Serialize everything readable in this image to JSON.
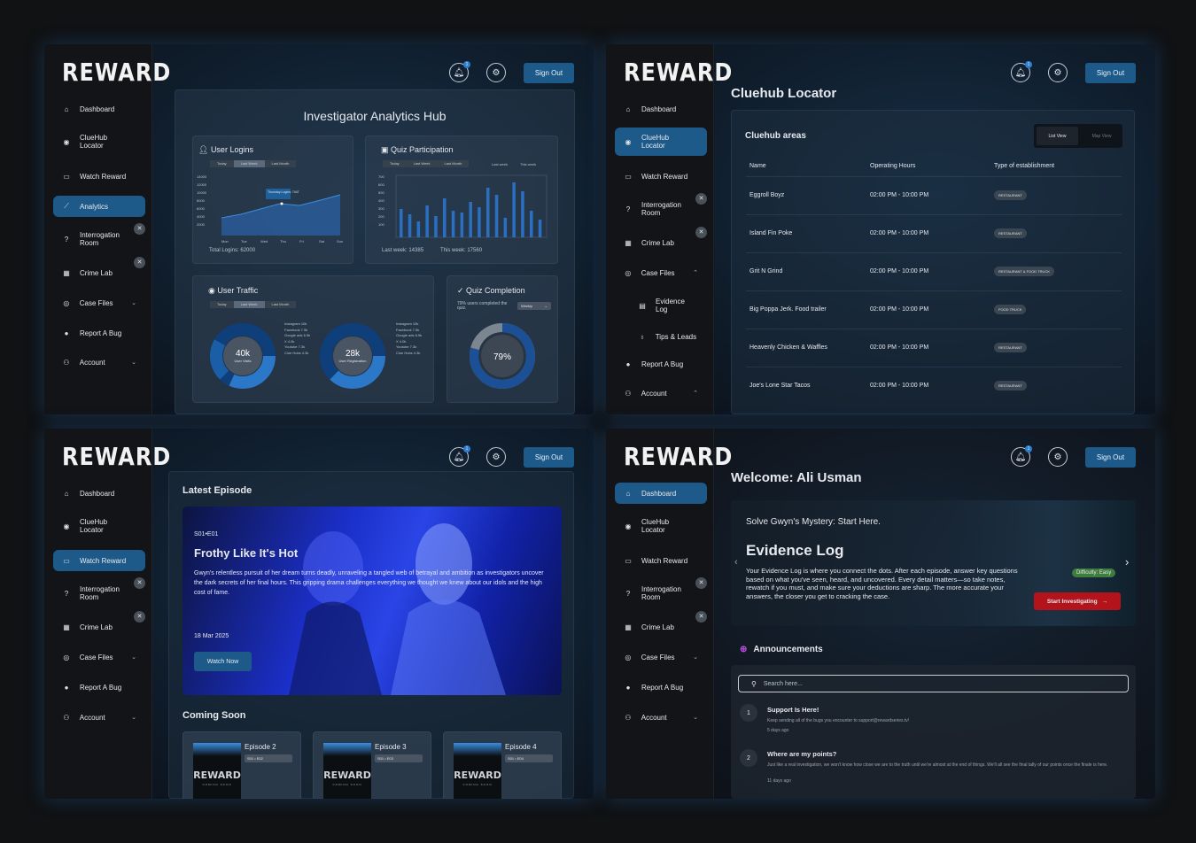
{
  "brand": "REWARD",
  "top": {
    "sign_out": "Sign Out",
    "notif_count": "1",
    "bell_icon": "bell-icon",
    "gear_icon": "gear-icon"
  },
  "nav1": [
    "Dashboard",
    "ClueHub Locator",
    "Watch Reward",
    "Analytics",
    "Interrogation Room",
    "Crime Lab",
    "Case Files",
    "Report A Bug",
    "Account"
  ],
  "nav2": [
    "Dashboard",
    "ClueHub Locator",
    "Watch Reward",
    "Interrogation Room",
    "Crime Lab",
    "Case Files",
    "Evidence Log",
    "Tips & Leads",
    "Report A Bug",
    "Account"
  ],
  "analytics": {
    "title": "Investigator Analytics Hub",
    "logins": {
      "title": "User Logins",
      "tabs": [
        "Today",
        "Last Week",
        "Last Month"
      ],
      "total": "Total Logins: 62000",
      "tooltip": "Thursday Logins: 7447",
      "ylabels": [
        "14000",
        "12000",
        "10000",
        "8000",
        "6000",
        "4000",
        "2000"
      ],
      "days": [
        "Mon",
        "Tue",
        "Wed",
        "Thu",
        "Fri",
        "Sat",
        "Sun"
      ]
    },
    "quiz": {
      "title": "Quiz Participation",
      "tabs": [
        "Today",
        "Last Week",
        "Last Month"
      ],
      "tabs2": [
        "Last week",
        "This week"
      ],
      "ylabels": [
        "700",
        "600",
        "500",
        "400",
        "300",
        "200",
        "100"
      ],
      "last_week": "Last week: 14385",
      "this_week": "This week: 17560"
    },
    "traffic": {
      "title": "User Traffic",
      "tabs": [
        "Today",
        "Last Week",
        "Last Month"
      ],
      "donut1_value": "40k",
      "donut1_label": "User Visits",
      "donut2_value": "28k",
      "donut2_label": "User Registration",
      "legend1": [
        "Instagram 10k",
        "Facebook 7.5k",
        "Google ads 6.9k",
        "X 4.0k",
        "Youtube 7.3k",
        "Clue Hubs 4.3k"
      ],
      "legend2": [
        "Instagram 10k",
        "Facebook 7.5k",
        "Google ads 6.9k",
        "X 4.0k",
        "Youtube 7.3k",
        "Clue Hubs 4.3k"
      ]
    },
    "completion": {
      "title": "Quiz Completion",
      "note": "79% users completed the quiz.",
      "select": "Weekly",
      "value": "79%",
      "fraction": 0.79
    }
  },
  "locator": {
    "title": "Cluehub Locator",
    "subtitle": "Cluehub areas",
    "view_list": "List View",
    "view_map": "Map View",
    "headers": [
      "Name",
      "Operating Hours",
      "Type of establishment"
    ],
    "rows": [
      {
        "name": "Eggroll Boyz",
        "hours": "02:00 PM - 10:00 PM",
        "type": "RESTAURANT"
      },
      {
        "name": "Island Fin Poke",
        "hours": "02:00 PM - 10:00 PM",
        "type": "RESTAURANT"
      },
      {
        "name": "Grit N Grind",
        "hours": "02:00 PM - 10:00 PM",
        "type": "RESTAURANT & FOOD TRUCK"
      },
      {
        "name": "Big Poppa Jerk. Food trailer",
        "hours": "02:00 PM - 10:00 PM",
        "type": "FOOD TRUCK"
      },
      {
        "name": "Heavenly Chicken & Waffles",
        "hours": "02:00 PM - 10:00 PM",
        "type": "RESTAURANT"
      },
      {
        "name": "Joe's Lone Star Tacos",
        "hours": "02:00 PM - 10:00 PM",
        "type": "RESTAURANT"
      }
    ]
  },
  "watch": {
    "latest": "Latest Episode",
    "code": "S01•E01",
    "title": "Frothy Like It's Hot",
    "desc": "Gwyn's relentless pursuit of her dream turns deadly, unraveling a tangled web of betrayal and ambition as investigators uncover the dark secrets of her final hours. This gripping drama challenges everything we thought we knew about our idols and the high cost of fame.",
    "date": "18 Mar 2025",
    "watch_now": "Watch Now",
    "coming": "Coming Soon",
    "episodes": [
      {
        "title": "Episode 2",
        "code": "S01 • E02"
      },
      {
        "title": "Episode 3",
        "code": "S01 • E03"
      },
      {
        "title": "Episode 4",
        "code": "S01 • E04"
      }
    ],
    "poster_tag": "COMING SOON"
  },
  "dashboard": {
    "welcome": "Welcome: Ali Usman",
    "hero_kicker": "Solve Gwyn's Mystery: Start Here.",
    "hero_title": "Evidence Log",
    "hero_text": "Your Evidence Log is where you connect the dots. After each episode, answer key questions based on what you've seen, heard, and uncovered. Every detail matters—so take notes, rewatch if you must, and make sure your deductions are sharp. The more accurate your answers, the closer you get to cracking the case.",
    "difficulty": "Difficulty: Easy",
    "start": "Start Investigating",
    "announcements": "Announcements",
    "search_placeholder": "Search here...",
    "items": [
      {
        "n": "1",
        "title": "Support Is Here!",
        "text": "Keep sending all of the bugs you encounter to support@rewardseries.tv!",
        "ago": "5 days ago"
      },
      {
        "n": "2",
        "title": "Where are my points?",
        "text": "Just like a real investigation, we won't know how close we are to the truth until we're almost at the end of things. We'll all see the final tally of our points once the finale is here.",
        "ago": "11 days ago"
      }
    ]
  },
  "colors": {
    "accent": "#1d5a8a",
    "bar": "#2b6fc2",
    "start": "#b3141b",
    "easy": "#3e7d3e"
  }
}
